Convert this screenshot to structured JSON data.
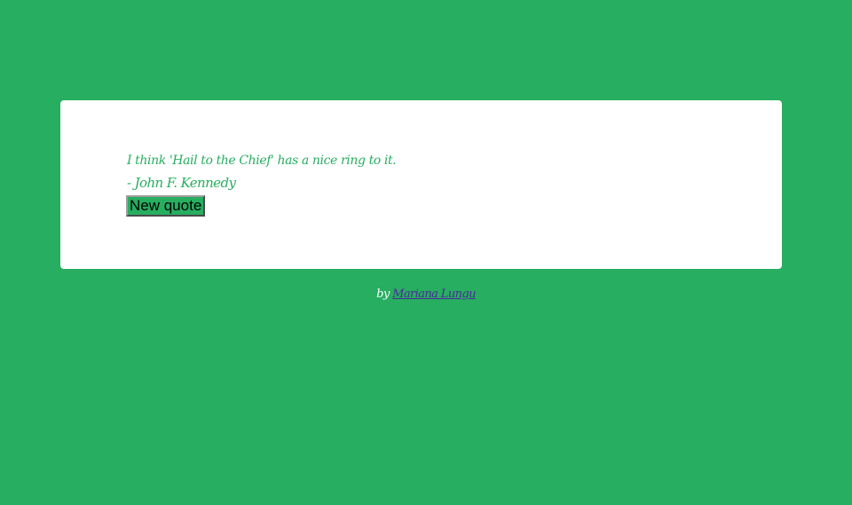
{
  "quote": {
    "text": "I think 'Hail to the Chief' has a nice ring to it.",
    "author": "- John F. Kennedy"
  },
  "button": {
    "label": "New quote"
  },
  "footer": {
    "prefix": "by",
    "author_link": "Mariana Lungu"
  },
  "colors": {
    "background": "#27ae60",
    "card": "#ffffff",
    "quote_text": "#27ae60",
    "link": "#4b2a9c"
  }
}
